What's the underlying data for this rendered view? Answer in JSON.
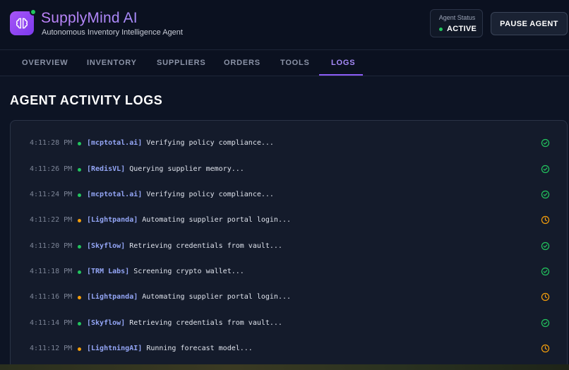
{
  "header": {
    "app_title": "SupplyMind AI",
    "app_subtitle": "Autonomous Inventory Intelligence Agent",
    "status_label": "Agent Status",
    "status_value": "ACTIVE",
    "pause_label": "PAUSE AGENT",
    "logo_icon": "brain-icon"
  },
  "tabs": [
    {
      "label": "OVERVIEW"
    },
    {
      "label": "INVENTORY"
    },
    {
      "label": "SUPPLIERS"
    },
    {
      "label": "ORDERS"
    },
    {
      "label": "TOOLS"
    },
    {
      "label": "LOGS",
      "active": true
    }
  ],
  "page": {
    "title": "AGENT ACTIVITY LOGS"
  },
  "colors": {
    "accent": "#8b5cf6",
    "success": "#22c55e",
    "pending": "#f59e0b",
    "source": "#93a5f5"
  },
  "logs": [
    {
      "time": "4:11:28 PM",
      "status": "success",
      "source": "[mcptotal.ai]",
      "message": "Verifying policy compliance...",
      "icon": "check-circle-icon"
    },
    {
      "time": "4:11:26 PM",
      "status": "success",
      "source": "[RedisVL]",
      "message": "Querying supplier memory...",
      "icon": "check-circle-icon"
    },
    {
      "time": "4:11:24 PM",
      "status": "success",
      "source": "[mcptotal.ai]",
      "message": "Verifying policy compliance...",
      "icon": "check-circle-icon"
    },
    {
      "time": "4:11:22 PM",
      "status": "pending",
      "source": "[Lightpanda]",
      "message": "Automating supplier portal login...",
      "icon": "clock-icon"
    },
    {
      "time": "4:11:20 PM",
      "status": "success",
      "source": "[Skyflow]",
      "message": "Retrieving credentials from vault...",
      "icon": "check-circle-icon"
    },
    {
      "time": "4:11:18 PM",
      "status": "success",
      "source": "[TRM Labs]",
      "message": "Screening crypto wallet...",
      "icon": "check-circle-icon"
    },
    {
      "time": "4:11:16 PM",
      "status": "pending",
      "source": "[Lightpanda]",
      "message": "Automating supplier portal login...",
      "icon": "clock-icon"
    },
    {
      "time": "4:11:14 PM",
      "status": "success",
      "source": "[Skyflow]",
      "message": "Retrieving credentials from vault...",
      "icon": "check-circle-icon"
    },
    {
      "time": "4:11:12 PM",
      "status": "pending",
      "source": "[LightningAI]",
      "message": "Running forecast model...",
      "icon": "clock-icon"
    }
  ]
}
